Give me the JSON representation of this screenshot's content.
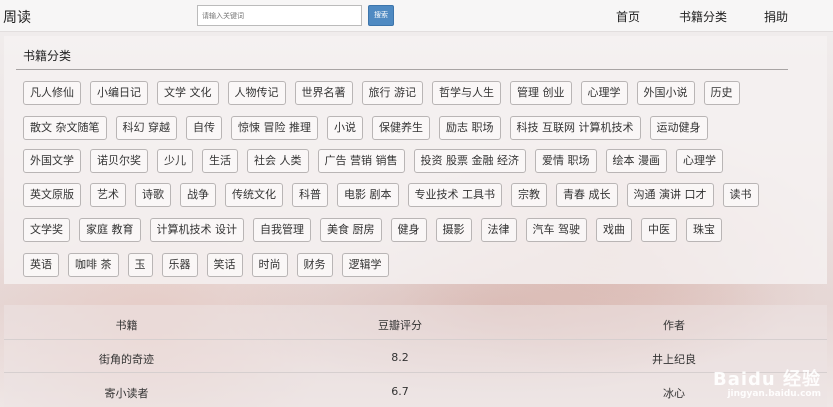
{
  "nav": {
    "brand": "周读",
    "search_placeholder": "请输入关键词",
    "search_button": "搜索",
    "links": [
      "首页",
      "书籍分类",
      "捐助"
    ]
  },
  "categories": {
    "title": "书籍分类",
    "rows": [
      [
        "凡人修仙",
        "小编日记",
        "文学 文化",
        "人物传记",
        "世界名著",
        "旅行 游记",
        "哲学与人生",
        "管理 创业",
        "心理学",
        "外国小说",
        "历史"
      ],
      [
        "散文 杂文随笔",
        "科幻 穿越",
        "自传",
        "惊悚 冒险 推理",
        "小说",
        "保健养生",
        "励志 职场",
        "科技 互联网 计算机技术",
        "运动健身"
      ],
      [
        "外国文学",
        "诺贝尔奖",
        "少儿",
        "生活",
        "社会 人类",
        "广告 营销 销售",
        "投资 股票 金融 经济",
        "爱情 职场",
        "绘本 漫画",
        "心理学"
      ],
      [
        "英文原版",
        "艺术",
        "诗歌",
        "战争",
        "传统文化",
        "科普",
        "电影 剧本",
        "专业技术 工具书",
        "宗教",
        "青春 成长",
        "沟通 演讲 口才",
        "读书"
      ],
      [
        "文学奖",
        "家庭 教育",
        "计算机技术 设计",
        "自我管理",
        "美食 厨房",
        "健身",
        "摄影",
        "法律",
        "汽车 驾驶",
        "戏曲",
        "中医",
        "珠宝"
      ],
      [
        "英语",
        "咖啡 茶",
        "玉",
        "乐器",
        "笑话",
        "时尚",
        "财务",
        "逻辑学"
      ]
    ]
  },
  "table": {
    "headers": [
      "书籍",
      "豆瓣评分",
      "作者"
    ],
    "rows": [
      [
        "街角的奇迹",
        "8.2",
        "井上纪良"
      ],
      [
        "寄小读者",
        "6.7",
        "冰心"
      ]
    ]
  },
  "watermark": {
    "logo": "Baidu 经验",
    "url": "jingyan.baidu.com"
  }
}
